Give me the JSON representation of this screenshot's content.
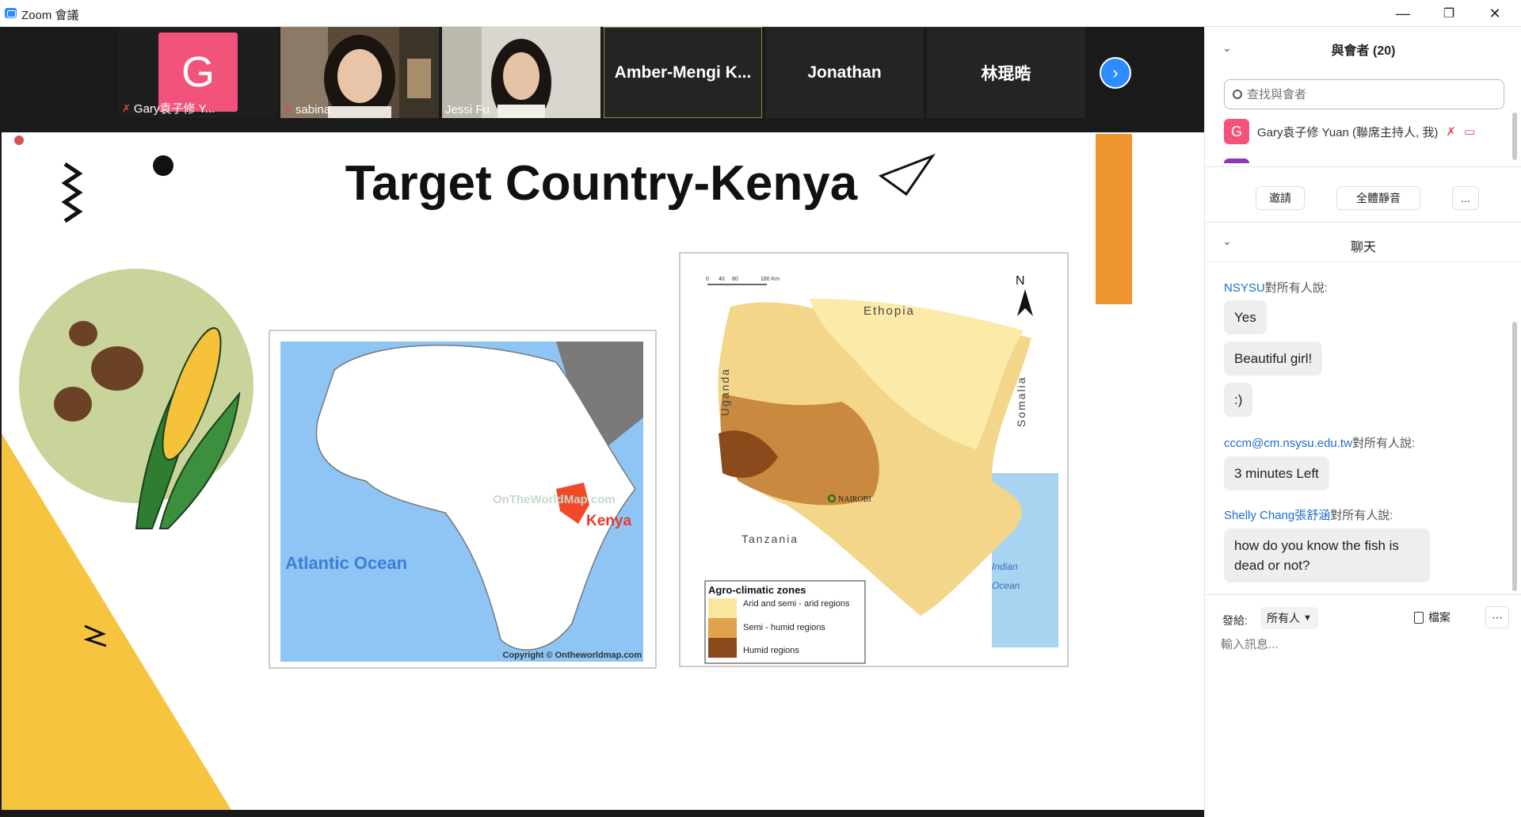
{
  "window": {
    "title": "Zoom 會議",
    "minimize": "—",
    "restore": "❐",
    "close": "✕"
  },
  "participants_strip": [
    {
      "name": "Gary袁子修 Y...",
      "avatar_letter": "G",
      "avatar_color": "#f2537b",
      "muted": true
    },
    {
      "name": "sabina",
      "muted": true
    },
    {
      "name": "Jessi Fu",
      "muted": false
    },
    {
      "name": "Amber-Mengi K..."
    },
    {
      "name": "Jonathan"
    },
    {
      "name": "林琨晧"
    }
  ],
  "slide": {
    "title": "Target Country-Kenya",
    "map1": {
      "ocean": "Atlantic Ocean",
      "country": "Kenya",
      "watermark": "OnTheWorldMap.com",
      "copyright": "Copyright © Ontheworldmap.com"
    },
    "map2": {
      "north": "N",
      "ethiopia": "Ethopia",
      "uganda": "Uganda",
      "somalia": "Somalia",
      "tanzania": "Tanzania",
      "nairobi": "NAIROBI",
      "indian": "Indian",
      "ocean": "Ocean",
      "scale": [
        "0",
        "40",
        "80",
        "160 Km"
      ],
      "legend": {
        "title": "Agro-climatic zones",
        "items": [
          "Arid and semi - arid regions",
          "Semi - humid regions",
          "Humid regions"
        ]
      }
    }
  },
  "panel": {
    "participants": {
      "title": "與會者 (20)",
      "search_placeholder": "查找與會者",
      "first": "Gary袁子修 Yuan (聯席主持人, 我)",
      "first_letter": "G",
      "invite": "邀請",
      "mute_all": "全體靜音",
      "more": "..."
    },
    "chat": {
      "title": "聊天",
      "groups": [
        {
          "sender": "NSYSU",
          "suffix": "對所有人說:",
          "messages": [
            "Yes",
            "Beautiful girl!",
            ":)"
          ]
        },
        {
          "sender": "cccm@cm.nsysu.edu.tw",
          "suffix": "對所有人說:",
          "messages": [
            "3 minutes Left"
          ]
        },
        {
          "sender": "Shelly Chang張舒涵",
          "suffix": "對所有人說:",
          "messages": [
            "how do you know the fish is dead or not?"
          ]
        }
      ],
      "send_to_label": "發給:",
      "send_to_value": "所有人",
      "file_label": "檔案",
      "input_placeholder": "輸入訊息..."
    }
  },
  "colors": {
    "accent": "#2d8cff",
    "orange": "#f0962e",
    "yellow": "#f7c440",
    "kenya": "#f04a2a",
    "ocean": "#8ec5f4",
    "circle": "#c9d49a"
  }
}
